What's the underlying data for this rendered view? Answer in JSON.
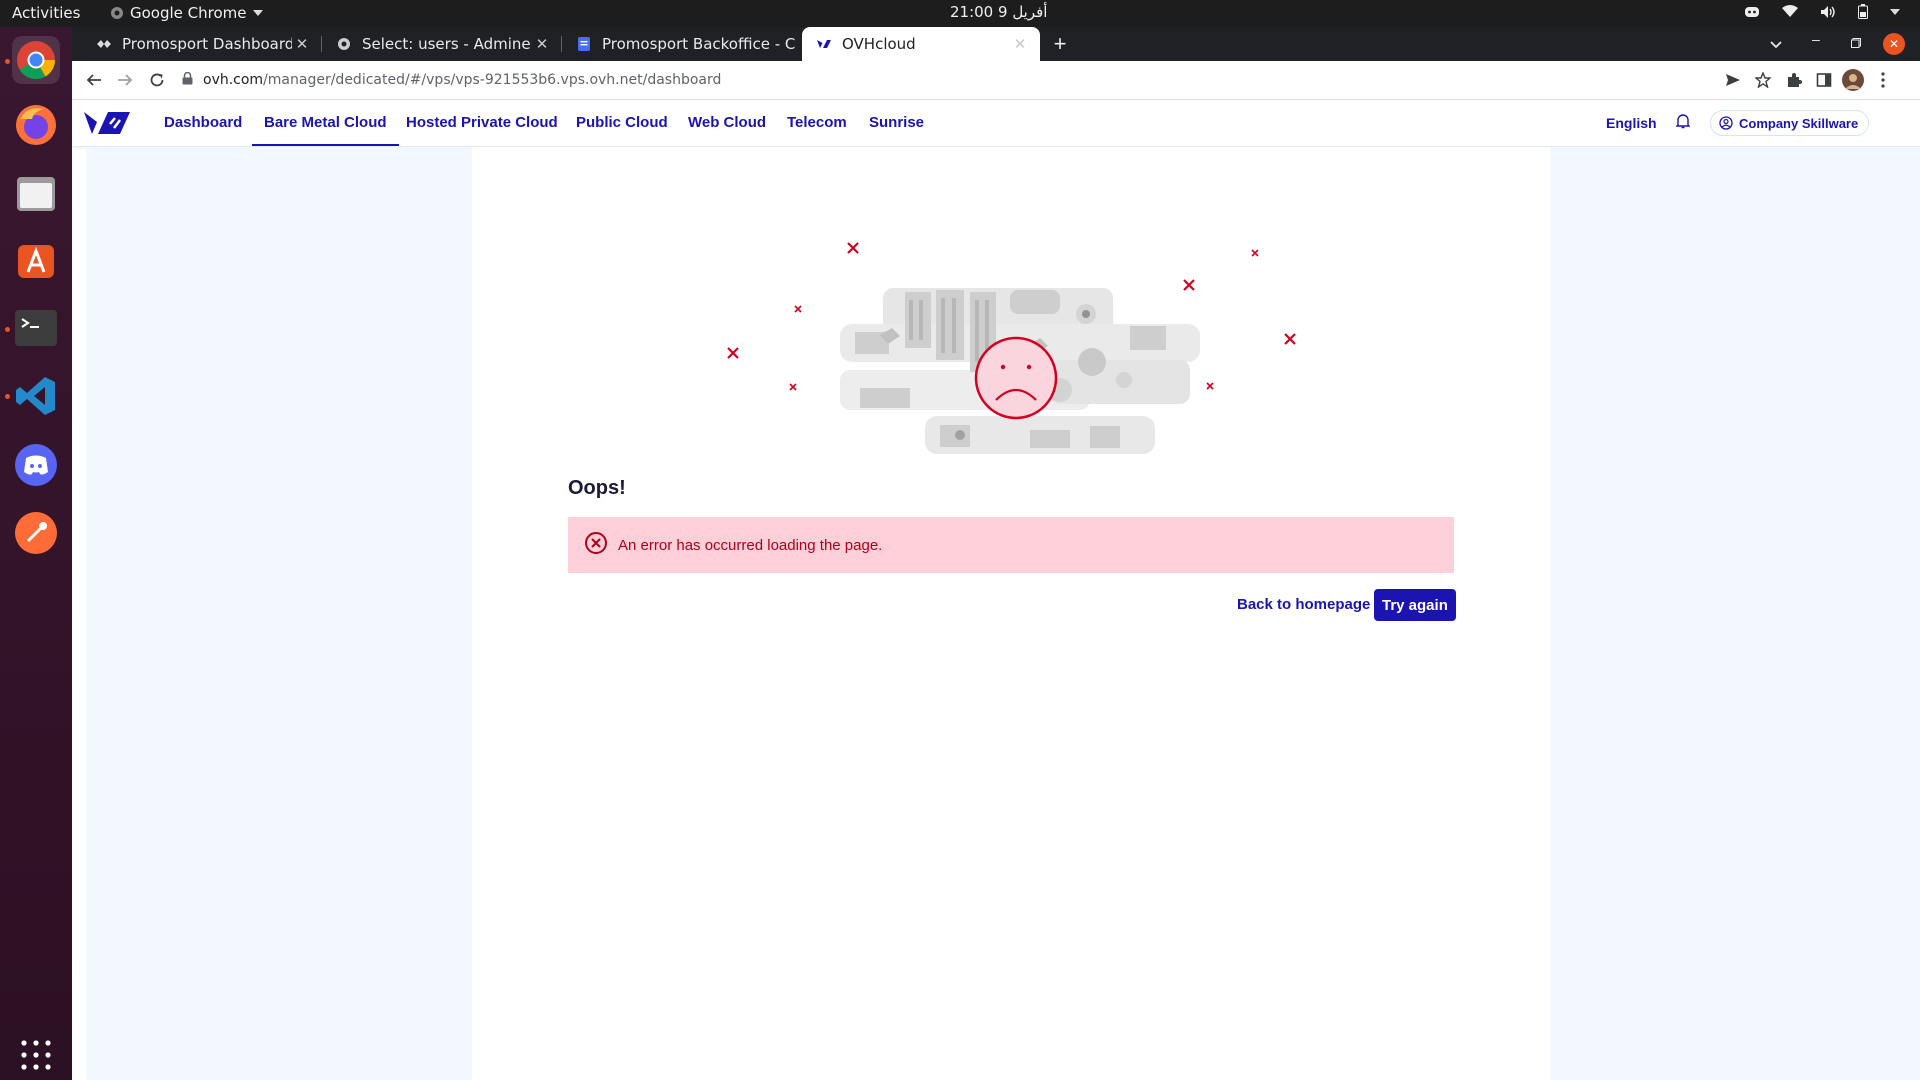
{
  "system": {
    "activities_label": "Activities",
    "app_label": "Google Chrome",
    "clock": "21:00  9 أفريل"
  },
  "dock": {
    "apps": [
      "chrome-icon",
      "firefox-icon",
      "files-icon",
      "app-center-icon",
      "terminal-icon",
      "vscode-icon",
      "discord-icon",
      "postman-icon",
      "show-apps-icon"
    ]
  },
  "browser": {
    "tabs": [
      {
        "title": "Promosport Dashboard",
        "active": false
      },
      {
        "title": "Select: users - Adminer",
        "active": false
      },
      {
        "title": "Promosport Backoffice - C",
        "active": false
      },
      {
        "title": "OVHcloud",
        "active": true
      }
    ],
    "url_host": "ovh.com",
    "url_path": "/manager/dedicated/#/vps/vps-921553b6.vps.ovh.net/dashboard"
  },
  "ovh_nav": {
    "items": [
      {
        "label": "Dashboard",
        "active": false
      },
      {
        "label": "Bare Metal Cloud",
        "active": true
      },
      {
        "label": "Hosted Private Cloud",
        "active": false
      },
      {
        "label": "Public Cloud",
        "active": false
      },
      {
        "label": "Web Cloud",
        "active": false
      },
      {
        "label": "Telecom",
        "active": false
      },
      {
        "label": "Sunrise",
        "active": false
      }
    ],
    "language": "English",
    "account": "Company Skillware"
  },
  "error_page": {
    "title": "Oops!",
    "message": "An error has occurred loading the page.",
    "back_link": "Back to homepage",
    "retry_button": "Try again"
  },
  "colors": {
    "brand": "#1b14b3",
    "error_bg": "#fdcfd9",
    "error_text": "#b0001a",
    "sad_face": "#d4001f"
  }
}
